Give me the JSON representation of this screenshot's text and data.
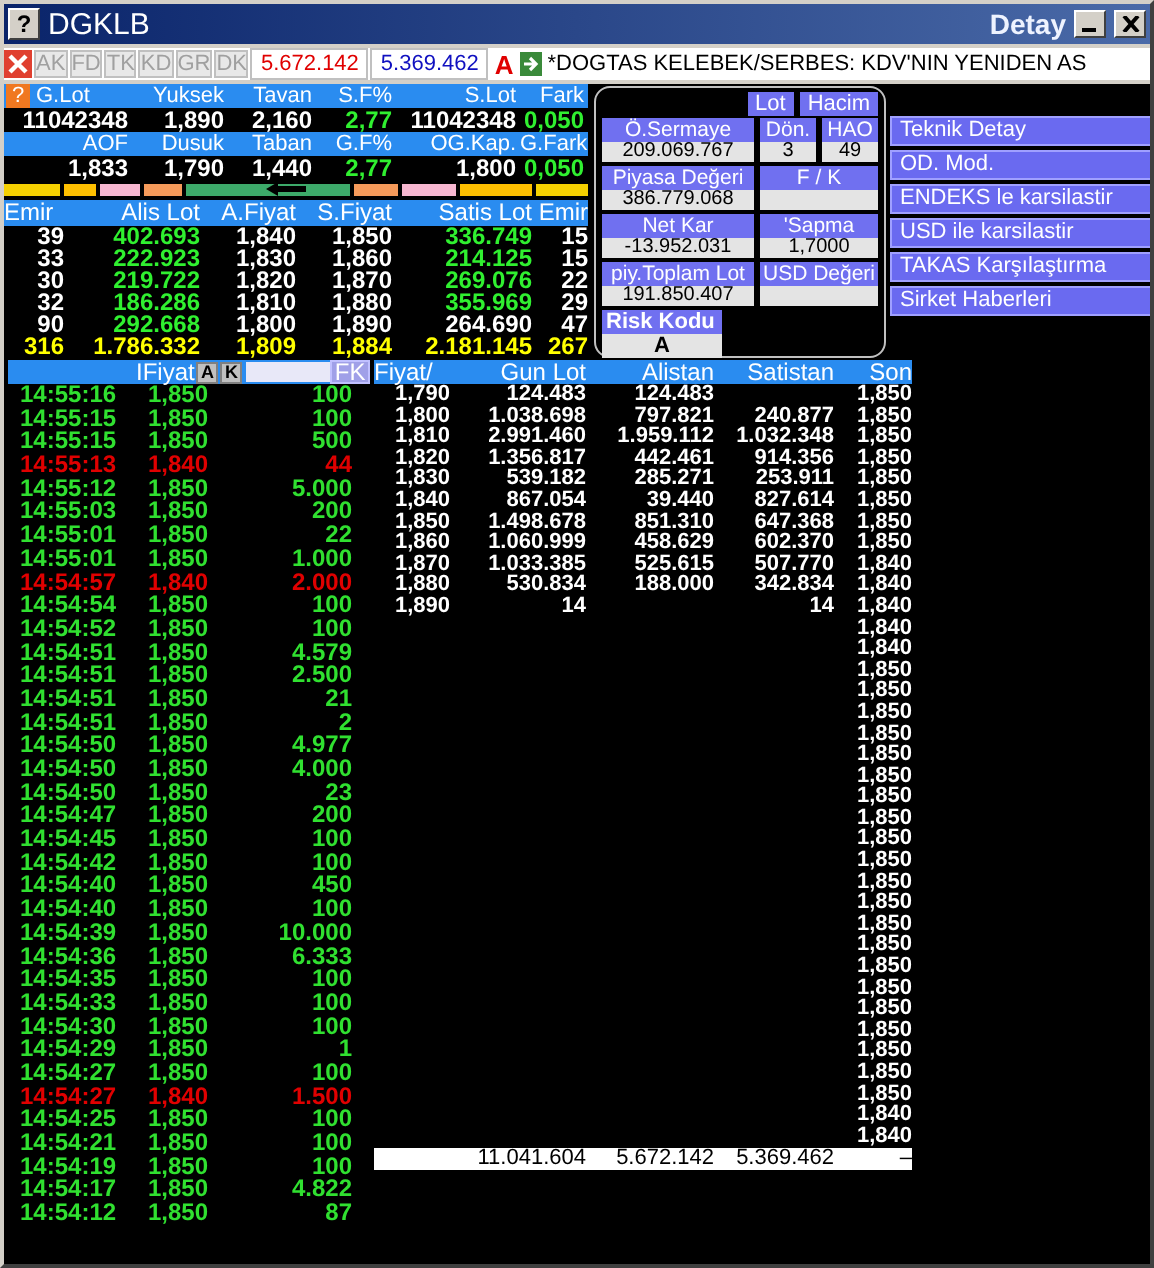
{
  "window": {
    "help_icon": "?",
    "title": "DGKLB",
    "subtitle": "Detay"
  },
  "summary_help_icon": "?",
  "toolbar": {
    "buttons": [
      {
        "label": "AK",
        "disabled": true
      },
      {
        "label": "FD",
        "disabled": true
      },
      {
        "label": "TK",
        "disabled": true
      },
      {
        "label": "KD",
        "disabled": true
      },
      {
        "label": "GR",
        "disabled": true
      },
      {
        "label": "DK",
        "disabled": true
      }
    ],
    "buy_total": "5.672.142",
    "sell_total": "5.369.462",
    "flag": "A",
    "ticker": "*DOGTAS KELEBEK/SERBES: KDV'NIN YENIDEN AS"
  },
  "summary": [
    {
      "headers": [
        "G.Lot",
        "Yuksek",
        "Tavan",
        "S.F%",
        "S.Lot",
        "Fark"
      ],
      "values": [
        "11042348",
        "1,890",
        "2,160",
        "2,77",
        "11042348",
        "0,050"
      ]
    },
    {
      "headers": [
        "AOF",
        "Dusuk",
        "Taban",
        "G.F%",
        "OG.Kap.",
        "G.Fark"
      ],
      "values": [
        "1,833",
        "1,790",
        "1,440",
        "2,77",
        "1,800",
        "0,050"
      ]
    }
  ],
  "order_book": {
    "columns": [
      "Emir",
      "Alis Lot",
      "A.Fiyat",
      "S.Fiyat",
      "Satis Lot",
      "Emir"
    ],
    "rows": [
      {
        "cells": [
          "39",
          "402.693",
          "1,840",
          "1,850",
          "336.749",
          "15"
        ],
        "sell_lot_highlighted": false
      },
      {
        "cells": [
          "33",
          "222.923",
          "1,830",
          "1,860",
          "214.125",
          "15"
        ],
        "sell_lot_highlighted": false
      },
      {
        "cells": [
          "30",
          "219.722",
          "1,820",
          "1,870",
          "269.076",
          "22"
        ],
        "sell_lot_highlighted": false
      },
      {
        "cells": [
          "32",
          "186.286",
          "1,810",
          "1,880",
          "355.969",
          "29"
        ],
        "sell_lot_highlighted": false
      },
      {
        "cells": [
          "90",
          "292.668",
          "1,800",
          "1,890",
          "264.690",
          "47"
        ],
        "sell_lot_highlighted": true
      }
    ],
    "totals": [
      "316",
      "1.786.332",
      "1,809",
      "1,884",
      "2.181.145",
      "267"
    ]
  },
  "details": {
    "toggles": [
      "Lot",
      "Hacim"
    ],
    "rows": [
      [
        {
          "label": "Ö.Sermaye",
          "value": "209.069.767"
        },
        {
          "label": "Dön.",
          "value": "3"
        },
        {
          "label": "HAO",
          "value": "49"
        }
      ],
      [
        {
          "label": "Piyasa Değeri",
          "value": "386.779.068"
        },
        {
          "label": "F / K"
        }
      ],
      [
        {
          "label": "Net Kar",
          "value": "-13.952.031"
        },
        {
          "label": "'Sapma",
          "value": "1,7000"
        }
      ],
      [
        {
          "label": "piy.Toplam Lot",
          "value": "191.850.407"
        },
        {
          "label": "USD Değeri"
        }
      ]
    ],
    "risk": {
      "label": "Risk Kodu",
      "value": "A"
    }
  },
  "links": [
    "Teknik Detay",
    "OD. Mod.",
    "ENDEKS le karsilastir",
    "USD ile karsilastir",
    "TAKAS Karşılaştırma",
    "Sirket Haberleri"
  ],
  "trades": {
    "header": "IFiyat",
    "buttons": [
      "A",
      "K"
    ],
    "filter_button": "FK",
    "rows": [
      {
        "time": "14:55:16",
        "price": "1,850",
        "lot": "100",
        "kind": "up"
      },
      {
        "time": "14:55:15",
        "price": "1,850",
        "lot": "100",
        "kind": "up"
      },
      {
        "time": "14:55:15",
        "price": "1,850",
        "lot": "500",
        "kind": "up"
      },
      {
        "time": "14:55:13",
        "price": "1,840",
        "lot": "44",
        "kind": "down"
      },
      {
        "time": "14:55:12",
        "price": "1,850",
        "lot": "5.000",
        "kind": "up"
      },
      {
        "time": "14:55:03",
        "price": "1,850",
        "lot": "200",
        "kind": "up"
      },
      {
        "time": "14:55:01",
        "price": "1,850",
        "lot": "22",
        "kind": "up"
      },
      {
        "time": "14:55:01",
        "price": "1,850",
        "lot": "1.000",
        "kind": "up"
      },
      {
        "time": "14:54:57",
        "price": "1,840",
        "lot": "2.000",
        "kind": "down"
      },
      {
        "time": "14:54:54",
        "price": "1,850",
        "lot": "100",
        "kind": "up"
      },
      {
        "time": "14:54:52",
        "price": "1,850",
        "lot": "100",
        "kind": "up"
      },
      {
        "time": "14:54:51",
        "price": "1,850",
        "lot": "4.579",
        "kind": "up"
      },
      {
        "time": "14:54:51",
        "price": "1,850",
        "lot": "2.500",
        "kind": "up"
      },
      {
        "time": "14:54:51",
        "price": "1,850",
        "lot": "21",
        "kind": "up"
      },
      {
        "time": "14:54:51",
        "price": "1,850",
        "lot": "2",
        "kind": "up"
      },
      {
        "time": "14:54:50",
        "price": "1,850",
        "lot": "4.977",
        "kind": "up"
      },
      {
        "time": "14:54:50",
        "price": "1,850",
        "lot": "4.000",
        "kind": "up"
      },
      {
        "time": "14:54:50",
        "price": "1,850",
        "lot": "23",
        "kind": "up"
      },
      {
        "time": "14:54:47",
        "price": "1,850",
        "lot": "200",
        "kind": "up"
      },
      {
        "time": "14:54:45",
        "price": "1,850",
        "lot": "100",
        "kind": "up"
      },
      {
        "time": "14:54:42",
        "price": "1,850",
        "lot": "100",
        "kind": "up"
      },
      {
        "time": "14:54:40",
        "price": "1,850",
        "lot": "450",
        "kind": "up"
      },
      {
        "time": "14:54:40",
        "price": "1,850",
        "lot": "100",
        "kind": "up"
      },
      {
        "time": "14:54:39",
        "price": "1,850",
        "lot": "10.000",
        "kind": "up"
      },
      {
        "time": "14:54:36",
        "price": "1,850",
        "lot": "6.333",
        "kind": "up"
      },
      {
        "time": "14:54:35",
        "price": "1,850",
        "lot": "100",
        "kind": "up"
      },
      {
        "time": "14:54:33",
        "price": "1,850",
        "lot": "100",
        "kind": "up"
      },
      {
        "time": "14:54:30",
        "price": "1,850",
        "lot": "100",
        "kind": "up"
      },
      {
        "time": "14:54:29",
        "price": "1,850",
        "lot": "1",
        "kind": "up"
      },
      {
        "time": "14:54:27",
        "price": "1,850",
        "lot": "100",
        "kind": "up"
      },
      {
        "time": "14:54:27",
        "price": "1,840",
        "lot": "1.500",
        "kind": "down"
      },
      {
        "time": "14:54:25",
        "price": "1,850",
        "lot": "100",
        "kind": "up"
      },
      {
        "time": "14:54:21",
        "price": "1,850",
        "lot": "100",
        "kind": "up"
      },
      {
        "time": "14:54:19",
        "price": "1,850",
        "lot": "100",
        "kind": "up"
      },
      {
        "time": "14:54:17",
        "price": "1,850",
        "lot": "4.822",
        "kind": "up"
      },
      {
        "time": "14:54:12",
        "price": "1,850",
        "lot": "87",
        "kind": "up"
      }
    ]
  },
  "price_table": {
    "columns": [
      "Fiyat/",
      "Gun Lot",
      "Alistan",
      "Satistan",
      "Son"
    ],
    "rows": [
      {
        "fiyat": "1,790",
        "gun_lot": "124.483",
        "alistan": "124.483",
        "son": "1,850"
      },
      {
        "fiyat": "1,800",
        "gun_lot": "1.038.698",
        "alistan": "797.821",
        "satistan": "240.877",
        "son": "1,850"
      },
      {
        "fiyat": "1,810",
        "gun_lot": "2.991.460",
        "alistan": "1.959.112",
        "satistan": "1.032.348",
        "son": "1,850"
      },
      {
        "fiyat": "1,820",
        "gun_lot": "1.356.817",
        "alistan": "442.461",
        "satistan": "914.356",
        "son": "1,850"
      },
      {
        "fiyat": "1,830",
        "gun_lot": "539.182",
        "alistan": "285.271",
        "satistan": "253.911",
        "son": "1,850"
      },
      {
        "fiyat": "1,840",
        "gun_lot": "867.054",
        "alistan": "39.440",
        "satistan": "827.614",
        "son": "1,850"
      },
      {
        "fiyat": "1,850",
        "gun_lot": "1.498.678",
        "alistan": "851.310",
        "satistan": "647.368",
        "son": "1,850"
      },
      {
        "fiyat": "1,860",
        "gun_lot": "1.060.999",
        "alistan": "458.629",
        "satistan": "602.370",
        "son": "1,850"
      },
      {
        "fiyat": "1,870",
        "gun_lot": "1.033.385",
        "alistan": "525.615",
        "satistan": "507.770",
        "son": "1,840"
      },
      {
        "fiyat": "1,880",
        "gun_lot": "530.834",
        "alistan": "188.000",
        "satistan": "342.834",
        "son": "1,840"
      },
      {
        "fiyat": "1,890",
        "gun_lot": "14",
        "satistan": "14",
        "son": "1,840"
      },
      {
        "son": "1,840"
      },
      {
        "son": "1,840"
      },
      {
        "son": "1,850"
      },
      {
        "son": "1,850"
      },
      {
        "son": "1,850"
      },
      {
        "son": "1,850"
      },
      {
        "son": "1,850"
      },
      {
        "son": "1,850"
      },
      {
        "son": "1,850"
      },
      {
        "son": "1,850"
      },
      {
        "son": "1,850"
      },
      {
        "son": "1,850"
      },
      {
        "son": "1,850"
      },
      {
        "son": "1,850"
      },
      {
        "son": "1,850"
      },
      {
        "son": "1,850"
      },
      {
        "son": "1,850"
      },
      {
        "son": "1,850"
      },
      {
        "son": "1,850"
      },
      {
        "son": "1,850"
      },
      {
        "son": "1,850"
      },
      {
        "son": "1,850"
      },
      {
        "son": "1,850"
      },
      {
        "son": "1,840"
      },
      {
        "son": "1,840"
      }
    ],
    "totals": {
      "gun_lot": "11.041.604",
      "alistan": "5.672.142",
      "satistan": "5.369.462",
      "son": "–"
    }
  }
}
